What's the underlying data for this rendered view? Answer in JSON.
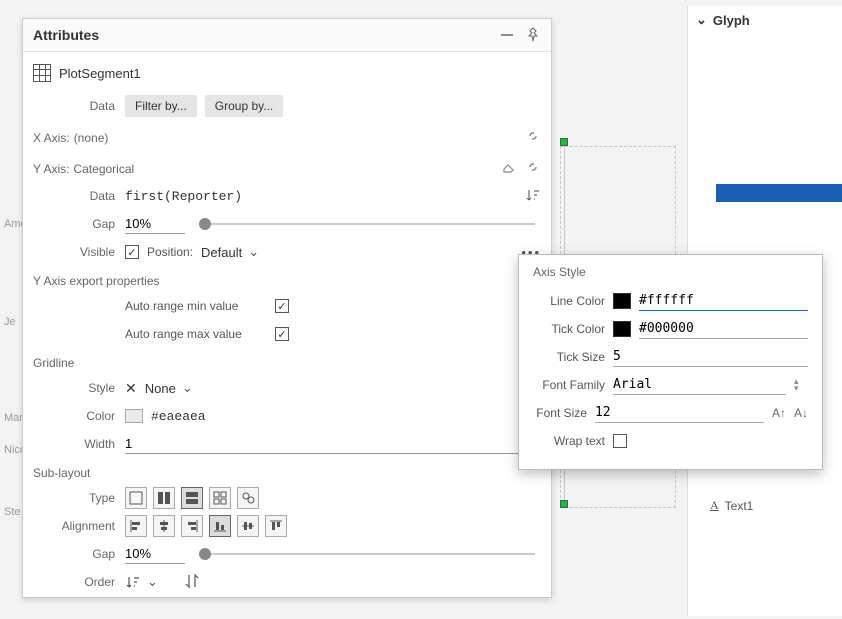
{
  "bg_labels": [
    "Amo",
    "Je",
    "Mar",
    "Nico",
    "Ste"
  ],
  "panel": {
    "title": "Attributes",
    "object_label": "PlotSegment1",
    "data_row": {
      "label": "Data",
      "filter": "Filter by...",
      "group": "Group by..."
    },
    "x_axis": {
      "label": "X Axis:",
      "value": "(none)"
    },
    "y_axis": {
      "label": "Y Axis:",
      "value": "Categorical",
      "data_label": "Data",
      "data_value": "first(Reporter)",
      "gap_label": "Gap",
      "gap_value": "10%",
      "visible_label": "Visible",
      "visible_checked": true,
      "position_label": "Position:",
      "position_value": "Default"
    },
    "y_export": {
      "heading": "Y Axis export properties",
      "auto_min_label": "Auto range min value",
      "auto_min_checked": true,
      "auto_max_label": "Auto range max value",
      "auto_max_checked": true
    },
    "gridline": {
      "heading": "Gridline",
      "style_label": "Style",
      "style_value": "None",
      "color_label": "Color",
      "color_value": "#eaeaea",
      "width_label": "Width",
      "width_value": "1"
    },
    "sublayout": {
      "heading": "Sub-layout",
      "type_label": "Type",
      "alignment_label": "Alignment",
      "gap_label": "Gap",
      "gap_value": "10%",
      "order_label": "Order"
    }
  },
  "axis_style": {
    "title": "Axis Style",
    "line_color_label": "Line Color",
    "line_color_value": "#ffffff",
    "line_color_swatch": "#000000",
    "tick_color_label": "Tick Color",
    "tick_color_value": "#000000",
    "tick_color_swatch": "#000000",
    "tick_size_label": "Tick Size",
    "tick_size_value": "5",
    "font_family_label": "Font Family",
    "font_family_value": "Arial",
    "font_size_label": "Font Size",
    "font_size_value": "12",
    "wrap_label": "Wrap text",
    "wrap_checked": false
  },
  "glyph": {
    "title": "Glyph",
    "text_mark": "Text1"
  }
}
